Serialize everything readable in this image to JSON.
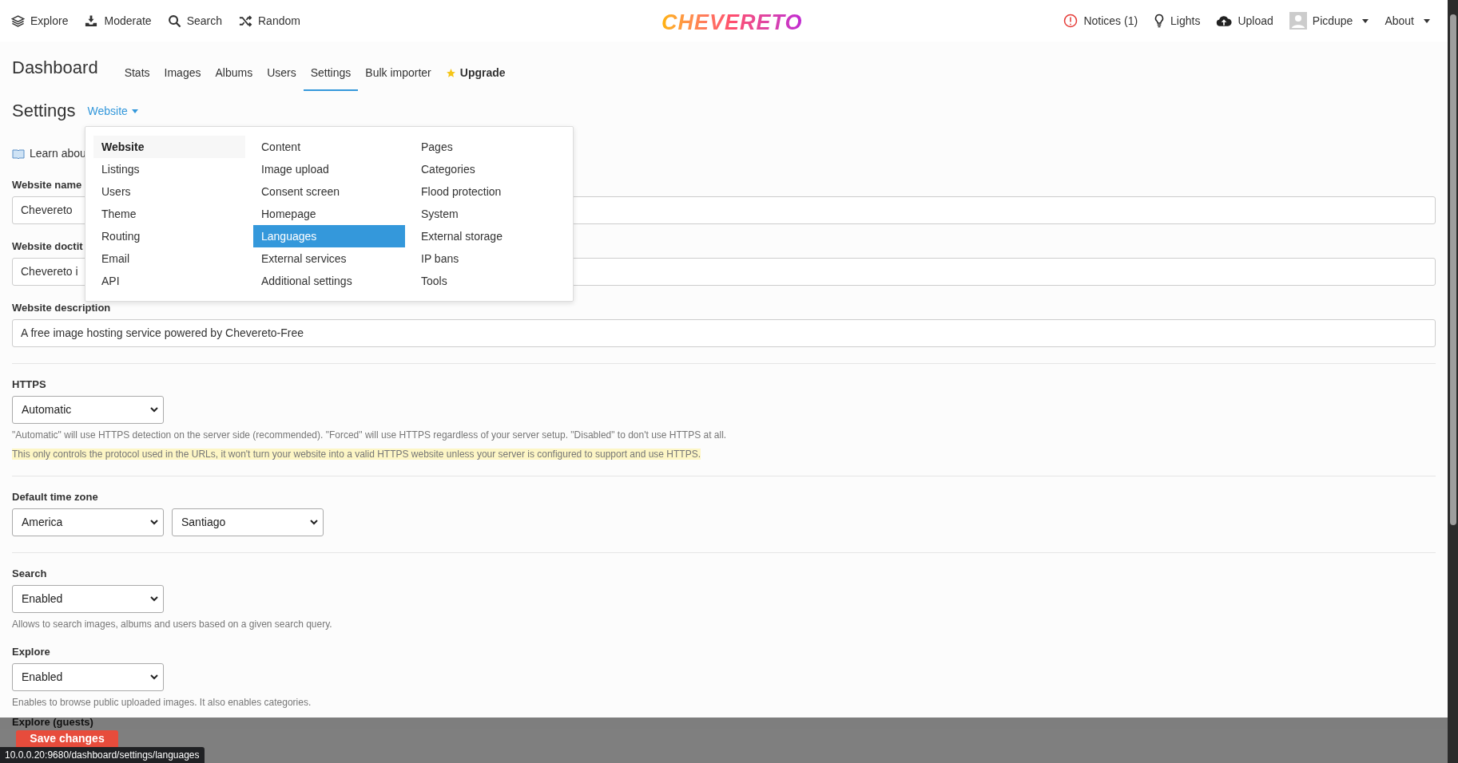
{
  "topbar": {
    "left": [
      {
        "label": "Explore"
      },
      {
        "label": "Moderate"
      },
      {
        "label": "Search"
      },
      {
        "label": "Random"
      }
    ],
    "logo": "CHEVERETO",
    "right": [
      {
        "label": "Notices (1)",
        "kind": "notice"
      },
      {
        "label": "Lights",
        "kind": "plain"
      },
      {
        "label": "Upload",
        "kind": "plain"
      },
      {
        "label": "Picdupe",
        "kind": "user"
      },
      {
        "label": "About",
        "kind": "menu"
      }
    ]
  },
  "dashboard": {
    "title": "Dashboard",
    "tabs": [
      {
        "label": "Stats",
        "selected": false,
        "kind": "tab"
      },
      {
        "label": "Images",
        "selected": false,
        "kind": "tab"
      },
      {
        "label": "Albums",
        "selected": false,
        "kind": "tab"
      },
      {
        "label": "Users",
        "selected": false,
        "kind": "tab"
      },
      {
        "label": "Settings",
        "selected": true,
        "kind": "tab"
      },
      {
        "label": "Bulk importer",
        "selected": false,
        "kind": "tab"
      },
      {
        "label": "Upgrade",
        "selected": false,
        "kind": "upgrade"
      }
    ]
  },
  "settings": {
    "title": "Settings",
    "section": "Website",
    "menu": {
      "expanded": true,
      "columns": [
        [
          {
            "label": "Website",
            "selected": true,
            "hovered": false
          },
          {
            "label": "Listings",
            "selected": false,
            "hovered": false
          },
          {
            "label": "Users",
            "selected": false,
            "hovered": false
          },
          {
            "label": "Theme",
            "selected": false,
            "hovered": false
          },
          {
            "label": "Routing",
            "selected": false,
            "hovered": false
          },
          {
            "label": "Email",
            "selected": false,
            "hovered": false
          },
          {
            "label": "API",
            "selected": false,
            "hovered": false
          }
        ],
        [
          {
            "label": "Content",
            "selected": false,
            "hovered": false
          },
          {
            "label": "Image upload",
            "selected": false,
            "hovered": false
          },
          {
            "label": "Consent screen",
            "selected": false,
            "hovered": false
          },
          {
            "label": "Homepage",
            "selected": false,
            "hovered": false
          },
          {
            "label": "Languages",
            "selected": false,
            "hovered": true
          },
          {
            "label": "External services",
            "selected": false,
            "hovered": false
          },
          {
            "label": "Additional settings",
            "selected": false,
            "hovered": false
          }
        ],
        [
          {
            "label": "Pages",
            "selected": false,
            "hovered": false
          },
          {
            "label": "Categories",
            "selected": false,
            "hovered": false
          },
          {
            "label": "Flood protection",
            "selected": false,
            "hovered": false
          },
          {
            "label": "System",
            "selected": false,
            "hovered": false
          },
          {
            "label": "External storage",
            "selected": false,
            "hovered": false
          },
          {
            "label": "IP bans",
            "selected": false,
            "hovered": false
          },
          {
            "label": "Tools",
            "selected": false,
            "hovered": false
          }
        ]
      ]
    }
  },
  "learn": "Learn abou",
  "sections": [
    [
      {
        "kind": "text",
        "label": "Website name",
        "value": "Chevereto"
      },
      {
        "kind": "text",
        "label": "Website doctit",
        "value": "Chevereto i"
      },
      {
        "kind": "text",
        "label": "Website description",
        "value": "A free image hosting service powered by Chevereto-Free"
      }
    ],
    [
      {
        "kind": "select",
        "label": "HTTPS",
        "values": [
          "Automatic"
        ],
        "help": [
          {
            "text": "\"Automatic\" will use HTTPS detection on the server side (recommended). \"Forced\" will use HTTPS regardless of your server setup. \"Disabled\" to don't use HTTPS at all.",
            "highlight": false
          },
          {
            "text": "This only controls the protocol used in the URLs, it won't turn your website into a valid HTTPS website unless your server is configured to support and use HTTPS.",
            "highlight": true
          }
        ]
      }
    ],
    [
      {
        "kind": "select",
        "label": "Default time zone",
        "values": [
          "America",
          "Santiago"
        ]
      }
    ],
    [
      {
        "kind": "select",
        "label": "Search",
        "values": [
          "Enabled"
        ],
        "help": [
          {
            "text": "Allows to search images, albums and users based on a given search query.",
            "highlight": false
          }
        ]
      },
      {
        "kind": "select",
        "label": "Explore",
        "values": [
          "Enabled"
        ],
        "help": [
          {
            "text": "Enables to browse public uploaded images. It also enables categories.",
            "highlight": false
          }
        ]
      },
      {
        "kind": "covered",
        "label": "Explore (guests)"
      }
    ]
  ],
  "save": "Save changes",
  "status_url": "10.0.0.20:9680/dashboard/settings/languages"
}
